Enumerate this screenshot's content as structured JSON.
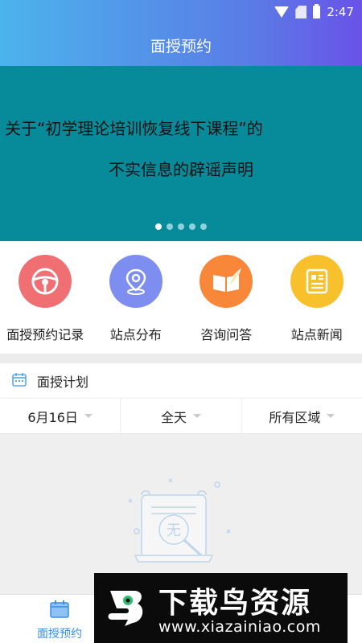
{
  "status_bar": {
    "time": "2:47"
  },
  "header": {
    "title": "面授预约"
  },
  "banner": {
    "line1": "关于“初学理论培训恢复线下课程”的",
    "line2": "不实信息的辟谣声明",
    "dot_count": 5,
    "active_dot": 0
  },
  "quick_links": [
    {
      "label": "面授预约记录",
      "icon": "steering-wheel-icon",
      "color": "#ef6f72"
    },
    {
      "label": "站点分布",
      "icon": "location-pin-icon",
      "color": "#7e8ef0"
    },
    {
      "label": "咨询问答",
      "icon": "book-feather-icon",
      "color": "#f8873a"
    },
    {
      "label": "站点新闻",
      "icon": "newspaper-icon",
      "color": "#f8c12c"
    }
  ],
  "plan": {
    "title": "面授计划",
    "filters": {
      "date": "6月16日",
      "time": "全天",
      "region": "所有区域"
    },
    "empty_mark": "无"
  },
  "tabbar": {
    "tab1_label": "面授预约"
  },
  "watermark": {
    "title": "下载鸟资源",
    "url": "www.xiazainiao.com"
  },
  "colors": {
    "accent": "#3a8de6",
    "banner_bg": "#078b9b"
  }
}
